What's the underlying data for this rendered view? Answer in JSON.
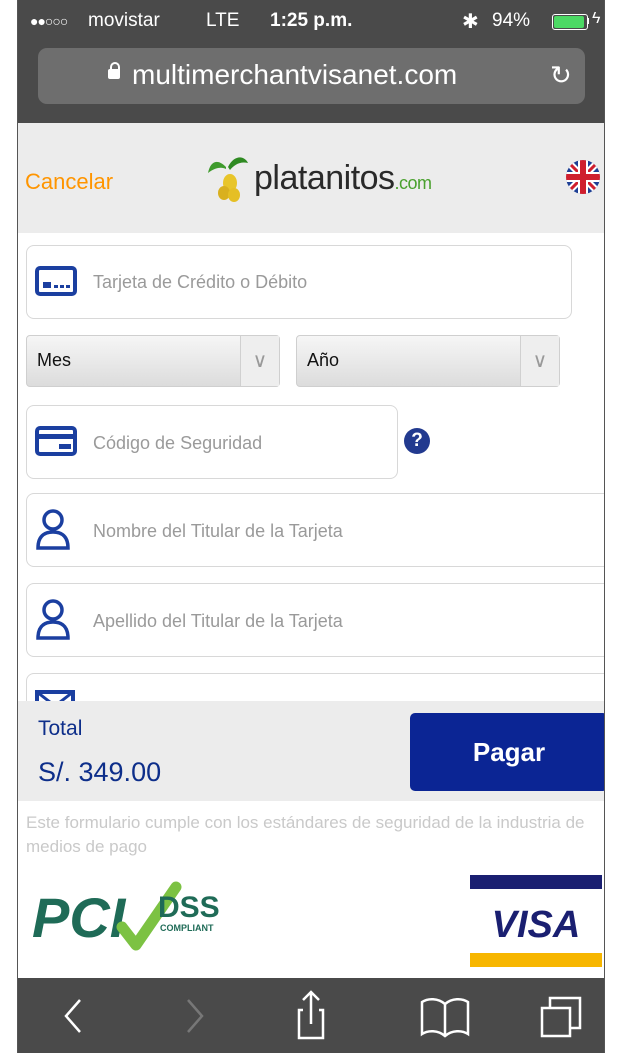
{
  "status_bar": {
    "signal": "●●○○○",
    "carrier": "movistar",
    "network": "LTE",
    "time": "1:25 p.m.",
    "battery": "94%",
    "battery_level": 0.94
  },
  "browser": {
    "url": "multimerchantvisanet.com"
  },
  "header": {
    "cancel_label": "Cancelar",
    "logo_text": "platanitos",
    "logo_suffix": ".com"
  },
  "form": {
    "card_placeholder": "Tarjeta de Crédito o Débito",
    "month_label": "Mes",
    "year_label": "Año",
    "security_placeholder": "Código de Seguridad",
    "first_name_placeholder": "Nombre del Titular de la Tarjeta",
    "last_name_placeholder": "Apellido del Titular de la Tarjeta"
  },
  "summary": {
    "total_label": "Total",
    "total_amount": "S/. 349.00",
    "pay_label": "Pagar"
  },
  "footer": {
    "security_note": "Este formulario cumple con los estándares de seguridad de la industria de medios de pago",
    "pci_text": "PCI",
    "dss_text": "DSS",
    "compliant_text": "COMPLIANT",
    "visa_text": "VISA"
  },
  "colors": {
    "accent_orange": "#ff9500",
    "brand_blue": "#0b2594",
    "icon_blue": "#1b3fa0"
  }
}
